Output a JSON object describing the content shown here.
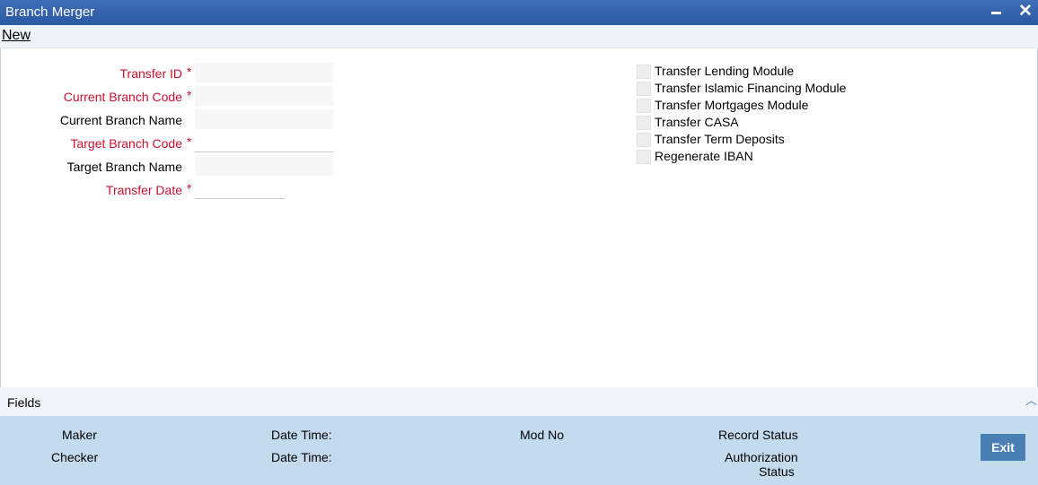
{
  "window": {
    "title": "Branch Merger",
    "close_glyph": "✕"
  },
  "toolbar": {
    "new_label": "New"
  },
  "form": {
    "fields": [
      {
        "label": "Transfer ID",
        "required": "*",
        "value": ""
      },
      {
        "label": "Current Branch Code",
        "required": "*",
        "value": ""
      },
      {
        "label": "Current Branch Name",
        "value": ""
      },
      {
        "label": "Target Branch Code",
        "required": "*",
        "value": ""
      },
      {
        "label": "Target Branch Name",
        "value": ""
      },
      {
        "label": "Transfer Date",
        "required": "*",
        "value": ""
      }
    ],
    "checkboxes": [
      {
        "label": "Transfer Lending Module",
        "checked": false
      },
      {
        "label": "Transfer Islamic Financing Module",
        "checked": false
      },
      {
        "label": "Transfer Mortgages Module",
        "checked": false
      },
      {
        "label": "Transfer CASA",
        "checked": false
      },
      {
        "label": "Transfer Term Deposits",
        "checked": false
      },
      {
        "label": "Regenerate IBAN",
        "checked": false
      }
    ]
  },
  "fields_bar": {
    "label": "Fields",
    "caret_icon": "chevron-up-icon"
  },
  "audit": {
    "maker_label": "Maker",
    "checker_label": "Checker",
    "maker_datetime_label": "Date Time:",
    "checker_datetime_label": "Date Time:",
    "mod_no_label": "Mod No",
    "record_status_label": "Record Status",
    "authorization_status_label_line1": "Authorization",
    "authorization_status_label_line2": "Status",
    "exit_label": "Exit"
  },
  "colors": {
    "title_bar": "#2f5fa8",
    "required_label": "#c8102e",
    "audit_bar": "#c4dbee",
    "exit_button": "#4a7fb5"
  }
}
